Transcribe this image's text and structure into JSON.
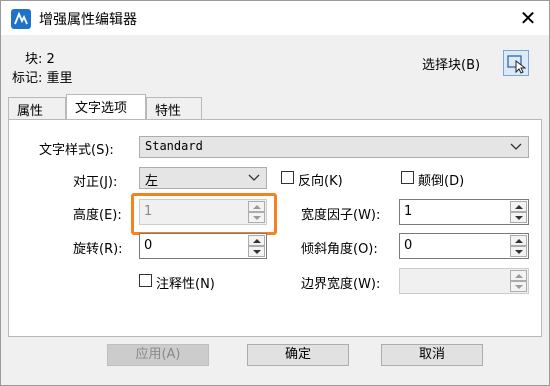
{
  "window": {
    "title": "增强属性编辑器",
    "close_glyph": "✕"
  },
  "info": {
    "block_label": "块: 2",
    "tag_label": "标记: 重里",
    "select_block_label": "选择块(B)"
  },
  "tabs": [
    {
      "label": "属性",
      "active": false
    },
    {
      "label": "文字选项",
      "active": true
    },
    {
      "label": "特性",
      "active": false
    }
  ],
  "form": {
    "text_style_label": "文字样式(S):",
    "text_style_value": "Standard",
    "justify_label": "对正(J):",
    "justify_value": "左",
    "backwards_label": "反向(K)",
    "upside_down_label": "颠倒(D)",
    "height_label": "高度(E):",
    "height_value": "1",
    "width_factor_label": "宽度因子(W):",
    "width_factor_value": "1",
    "rotation_label": "旋转(R):",
    "rotation_value": "0",
    "oblique_label": "倾斜角度(O):",
    "oblique_value": "0",
    "annotative_label": "注释性(N)",
    "boundary_width_label": "边界宽度(W):",
    "boundary_width_value": ""
  },
  "buttons": {
    "apply": "应用(A)",
    "ok": "确定",
    "cancel": "取消"
  },
  "colors": {
    "highlight": "#f5821f",
    "accent_icon": "#1e73c9"
  }
}
